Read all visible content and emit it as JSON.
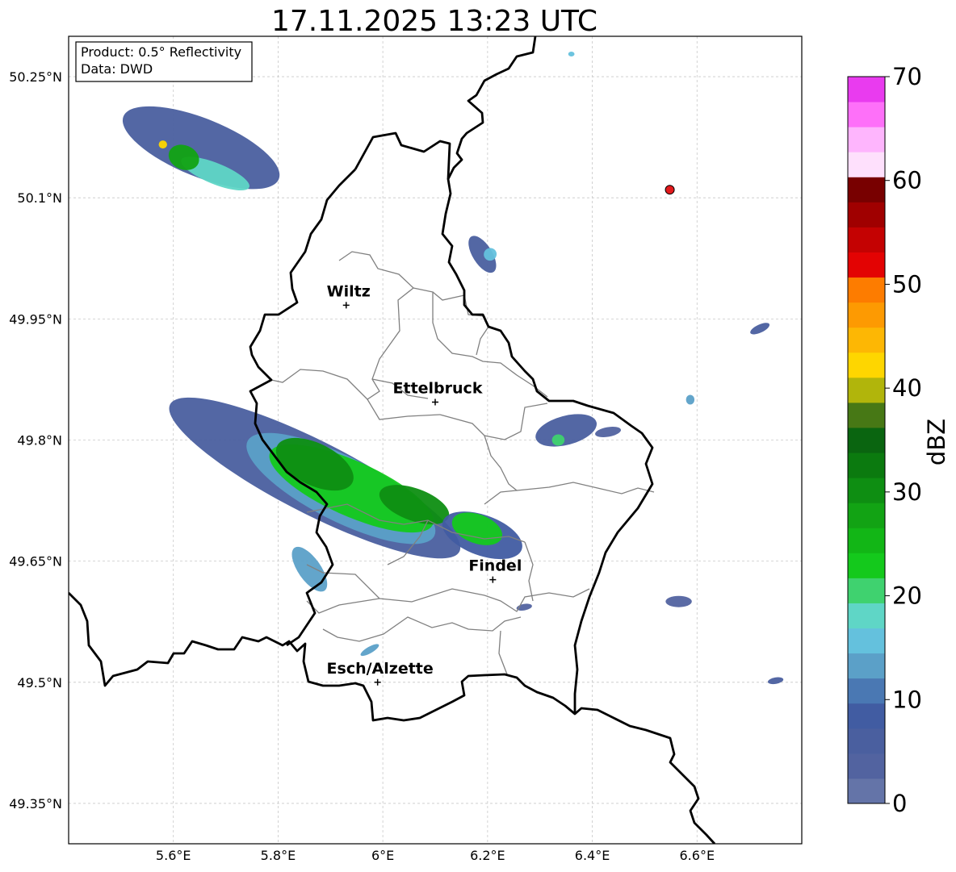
{
  "map": {
    "title": "17.11.2025 13:23 UTC",
    "info_lines": [
      "Product: 0.5° Reflectivity",
      "Data: DWD"
    ],
    "lon_range": [
      5.4,
      6.8
    ],
    "lat_range": [
      49.3,
      50.3
    ],
    "lon_ticks": [
      {
        "value": 5.6,
        "label": "5.6°E"
      },
      {
        "value": 5.8,
        "label": "5.8°E"
      },
      {
        "value": 6.0,
        "label": "6°E"
      },
      {
        "value": 6.2,
        "label": "6.2°E"
      },
      {
        "value": 6.4,
        "label": "6.4°E"
      },
      {
        "value": 6.6,
        "label": "6.6°E"
      }
    ],
    "lat_ticks": [
      {
        "value": 50.25,
        "label": "50.25°N"
      },
      {
        "value": 50.1,
        "label": "50.1°N"
      },
      {
        "value": 49.95,
        "label": "49.95°N"
      },
      {
        "value": 49.8,
        "label": "49.8°N"
      },
      {
        "value": 49.65,
        "label": "49.65°N"
      },
      {
        "value": 49.5,
        "label": "49.5°N"
      },
      {
        "value": 49.35,
        "label": "49.35°N"
      }
    ],
    "grid": true,
    "cities": [
      {
        "name": "Wiltz",
        "lon": 5.93,
        "lat": 49.967
      },
      {
        "name": "Ettelbruck",
        "lon": 6.1,
        "lat": 49.847
      },
      {
        "name": "Findel",
        "lon": 6.21,
        "lat": 49.627
      },
      {
        "name": "Esch/Alzette",
        "lon": 5.99,
        "lat": 49.5
      }
    ],
    "radar_site": {
      "lon": 6.548,
      "lat": 50.11,
      "color": "#e31a1c"
    }
  },
  "colorbar": {
    "label": "dBZ",
    "min": 0,
    "max": 70,
    "ticks": [
      {
        "value": 0,
        "label": "0"
      },
      {
        "value": 10,
        "label": "10"
      },
      {
        "value": 20,
        "label": "20"
      },
      {
        "value": 30,
        "label": "30"
      },
      {
        "value": 40,
        "label": "40"
      },
      {
        "value": 50,
        "label": "50"
      },
      {
        "value": 60,
        "label": "60"
      },
      {
        "value": 70,
        "label": "70"
      }
    ],
    "colors": [
      "#6474a8",
      "#5263a0",
      "#4a5f9f",
      "#415ca2",
      "#4a78b3",
      "#5ba0c8",
      "#64c1dd",
      "#5fd6c6",
      "#3fd26f",
      "#14c91c",
      "#12b616",
      "#12a314",
      "#0e8e12",
      "#0b7a0f",
      "#0a6510",
      "#477815",
      "#b1b50b",
      "#fed600",
      "#fdb704",
      "#fd9a02",
      "#fd7c00",
      "#e30303",
      "#c40202",
      "#a00000",
      "#780000",
      "#fee0fc",
      "#feb5fd",
      "#fe70f9",
      "#e93bef"
    ]
  },
  "echo_cells": [
    {
      "lon": 5.653,
      "lat": 50.162,
      "rx": 0.16,
      "ry": 0.036,
      "angle": 22,
      "dbz": 6
    },
    {
      "lon": 5.68,
      "lat": 50.13,
      "rx": 0.07,
      "ry": 0.013,
      "angle": 22,
      "dbz": 18
    },
    {
      "lon": 5.62,
      "lat": 50.15,
      "rx": 0.03,
      "ry": 0.015,
      "angle": 22,
      "dbz": 27
    },
    {
      "lon": 5.58,
      "lat": 50.166,
      "rx": 0.008,
      "ry": 0.005,
      "angle": 0,
      "dbz": 42
    },
    {
      "lon": 6.19,
      "lat": 50.03,
      "rx": 0.04,
      "ry": 0.012,
      "angle": 58,
      "dbz": 6
    },
    {
      "lon": 6.205,
      "lat": 50.03,
      "rx": 0.012,
      "ry": 0.008,
      "angle": 58,
      "dbz": 16
    },
    {
      "lon": 5.87,
      "lat": 49.753,
      "rx": 0.31,
      "ry": 0.045,
      "angle": 27,
      "dbz": 6
    },
    {
      "lon": 5.92,
      "lat": 49.74,
      "rx": 0.2,
      "ry": 0.04,
      "angle": 27,
      "dbz": 14
    },
    {
      "lon": 5.94,
      "lat": 49.74,
      "rx": 0.17,
      "ry": 0.034,
      "angle": 24,
      "dbz": 24
    },
    {
      "lon": 5.87,
      "lat": 49.77,
      "rx": 0.08,
      "ry": 0.026,
      "angle": 26,
      "dbz": 30
    },
    {
      "lon": 6.06,
      "lat": 49.72,
      "rx": 0.07,
      "ry": 0.02,
      "angle": 20,
      "dbz": 30
    },
    {
      "lon": 5.86,
      "lat": 49.64,
      "rx": 0.05,
      "ry": 0.014,
      "angle": 55,
      "dbz": 14
    },
    {
      "lon": 6.19,
      "lat": 49.682,
      "rx": 0.08,
      "ry": 0.025,
      "angle": 20,
      "dbz": 8
    },
    {
      "lon": 6.18,
      "lat": 49.69,
      "rx": 0.05,
      "ry": 0.018,
      "angle": 20,
      "dbz": 22
    },
    {
      "lon": 6.35,
      "lat": 49.812,
      "rx": 0.06,
      "ry": 0.018,
      "angle": -15,
      "dbz": 5
    },
    {
      "lon": 6.335,
      "lat": 49.8,
      "rx": 0.012,
      "ry": 0.007,
      "angle": 0,
      "dbz": 20
    },
    {
      "lon": 6.43,
      "lat": 49.81,
      "rx": 0.025,
      "ry": 0.006,
      "angle": -10,
      "dbz": 4
    },
    {
      "lon": 6.565,
      "lat": 49.6,
      "rx": 0.025,
      "ry": 0.007,
      "angle": 0,
      "dbz": 4
    },
    {
      "lon": 6.72,
      "lat": 49.938,
      "rx": 0.02,
      "ry": 0.005,
      "angle": -25,
      "dbz": 5
    },
    {
      "lon": 6.587,
      "lat": 49.85,
      "rx": 0.008,
      "ry": 0.006,
      "angle": 0,
      "dbz": 14
    },
    {
      "lon": 6.75,
      "lat": 49.502,
      "rx": 0.015,
      "ry": 0.004,
      "angle": -10,
      "dbz": 5
    },
    {
      "lon": 5.975,
      "lat": 49.54,
      "rx": 0.02,
      "ry": 0.004,
      "angle": -30,
      "dbz": 14
    },
    {
      "lon": 6.36,
      "lat": 50.278,
      "rx": 0.006,
      "ry": 0.003,
      "angle": 0,
      "dbz": 16
    },
    {
      "lon": 6.27,
      "lat": 49.593,
      "rx": 0.015,
      "ry": 0.004,
      "angle": -10,
      "dbz": 4
    }
  ]
}
